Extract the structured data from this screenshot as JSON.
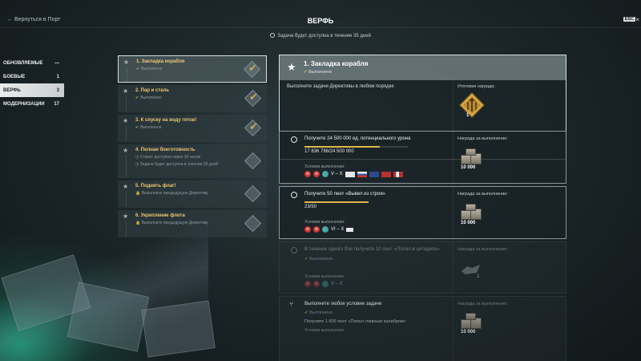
{
  "header": {
    "back_label": "← Вернуться в Порт",
    "title": "ВЕРФЬ",
    "esc_label": "ESC",
    "close_glyph": "×",
    "subtitle": "Задача будет доступна в течение 35 дней"
  },
  "sidebar": {
    "items": [
      {
        "label": "ОБНОВЛЯЕМЫЕ",
        "count": "—"
      },
      {
        "label": "БОЕВЫЕ",
        "count": "1"
      },
      {
        "label": "ВЕРФЬ",
        "count": "3"
      },
      {
        "label": "МОДЕРНИЗАЦИИ",
        "count": "17"
      }
    ]
  },
  "steps": [
    {
      "title": "1. Закладка корабля",
      "status": "Выполнено"
    },
    {
      "title": "2. Пар и сталь",
      "status": "Выполнено"
    },
    {
      "title": "3. К спуску на воду готов!",
      "status": "Выполнено"
    },
    {
      "title": "4. Полная боеготовность",
      "status": "Станет доступна через 18 часов",
      "status2": "Задача будет доступна в течение 35 дней"
    },
    {
      "title": "5. Поднять флаг!",
      "status": "Выполните предыдущую Директиву"
    },
    {
      "title": "6. Укрепление флота",
      "status": "Выполните предыдущую Директиву"
    }
  ],
  "directive": {
    "title": "1. Закладка корабля",
    "status": "Выполнено",
    "description": "Выполните задачи Директивы в любом порядке",
    "reward_label": "Итоговая награда:",
    "reward_count": "1"
  },
  "tasks": [
    {
      "title": "Получите 24 500 000 ед. потенциального урона",
      "progress_text": "17 836 796/24 500 000",
      "progress": 0.73,
      "conditions_label": "Условия выполнения:",
      "tier": "V – X",
      "reward_label": "Награда за выполнение:",
      "reward_amount": "10 000"
    },
    {
      "title": "Получите 50 лент «Вывел из строя»",
      "progress_text": "23/50",
      "progress": 0.46,
      "conditions_label": "Условия выполнения:",
      "tier": "VI – X",
      "reward_label": "Награда за выполнение:",
      "reward_amount": "10 000"
    },
    {
      "title": "В течение одного боя получите 10 лент «Попал в цитадель»",
      "status": "Выполнено",
      "conditions_label": "Условия выполнения:",
      "tier": "V – X",
      "reward_label": "Награда за выполнение:",
      "reward_amount": "1"
    },
    {
      "title": "Выполните любое условие задачи",
      "status": "Выполнено",
      "subtitle": "Получите 1 600 лент «Попал главным калибром»",
      "conditions_label": "Условия выполнения:",
      "reward_label": "Награда за выполнение:",
      "reward_amount": "10 000"
    }
  ],
  "colors": {
    "accent_gold": "#e0b54b",
    "active_nav_bg": "#e9ecec"
  }
}
